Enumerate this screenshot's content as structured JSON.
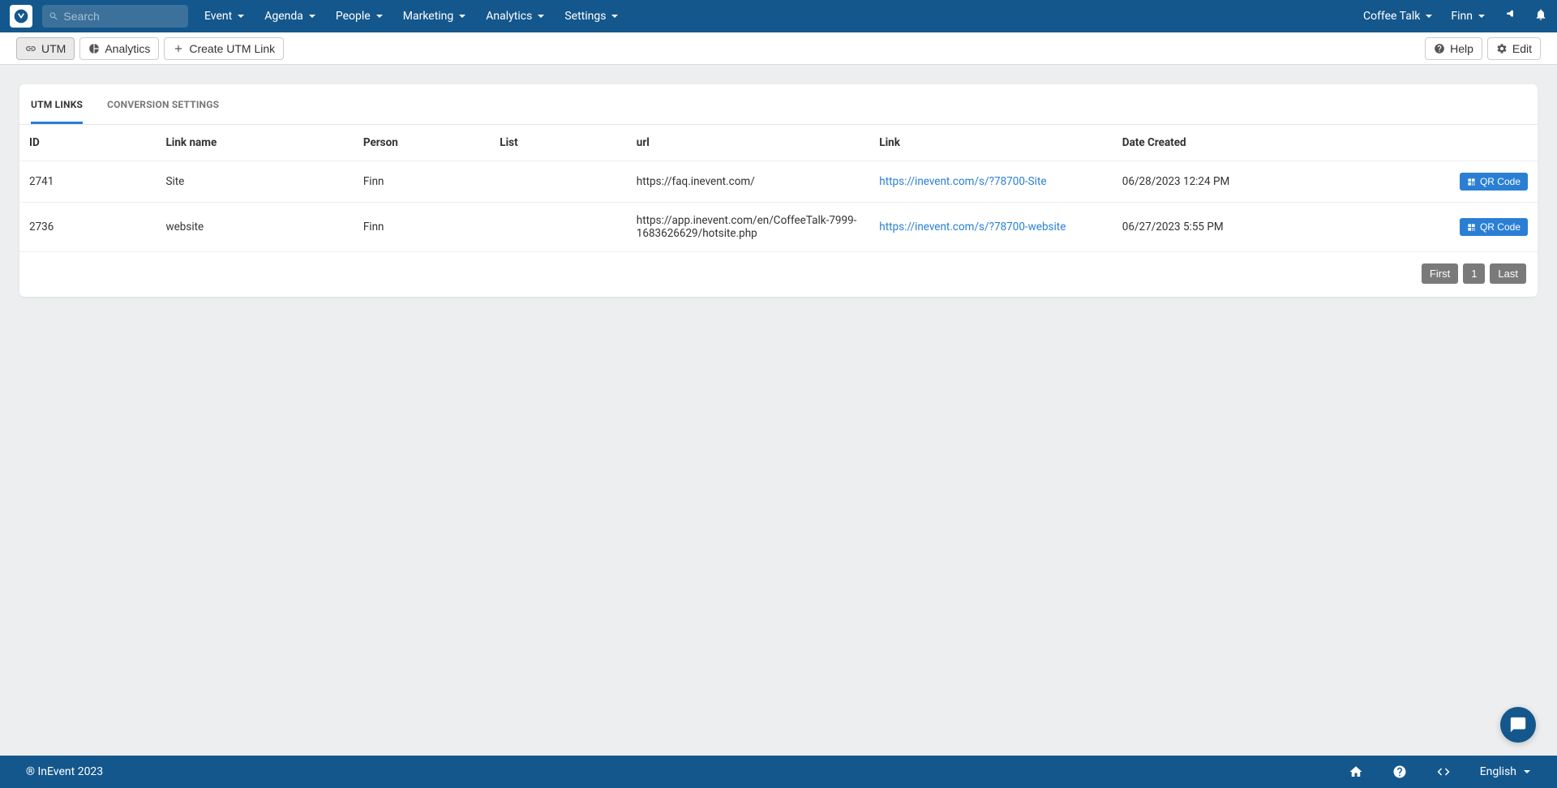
{
  "search": {
    "placeholder": "Search"
  },
  "nav": {
    "items": [
      {
        "label": "Event"
      },
      {
        "label": "Agenda"
      },
      {
        "label": "People"
      },
      {
        "label": "Marketing"
      },
      {
        "label": "Analytics"
      },
      {
        "label": "Settings"
      }
    ],
    "event_name": "Coffee Talk",
    "user_name": "Finn"
  },
  "toolbar": {
    "utm": "UTM",
    "analytics": "Analytics",
    "create": "Create UTM Link",
    "help": "Help",
    "edit": "Edit"
  },
  "tabs": {
    "utm_links": "UTM LINKS",
    "conversion": "CONVERSION SETTINGS"
  },
  "table": {
    "headers": {
      "id": "ID",
      "link_name": "Link name",
      "person": "Person",
      "list": "List",
      "url": "url",
      "link": "Link",
      "date": "Date Created"
    },
    "rows": [
      {
        "id": "2741",
        "link_name": "Site",
        "person": "Finn",
        "list": "",
        "url": "https://faq.inevent.com/",
        "link": "https://inevent.com/s/?78700-Site",
        "date": "06/28/2023 12:24 PM",
        "qr": "QR Code"
      },
      {
        "id": "2736",
        "link_name": "website",
        "person": "Finn",
        "list": "",
        "url": "https://app.inevent.com/en/CoffeeTalk-7999-1683626629/hotsite.php",
        "link": "https://inevent.com/s/?78700-website",
        "date": "06/27/2023 5:55 PM",
        "qr": "QR Code"
      }
    ]
  },
  "pagination": {
    "first": "First",
    "page": "1",
    "last": "Last"
  },
  "footer": {
    "copyright": "® InEvent 2023",
    "language": "English"
  }
}
